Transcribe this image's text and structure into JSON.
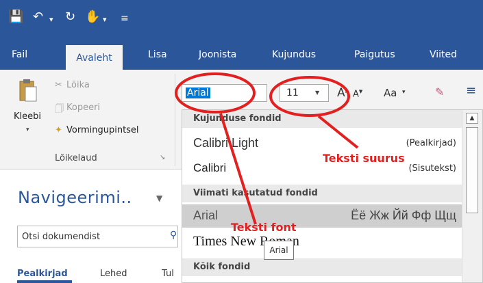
{
  "tabs": {
    "file": "Fail",
    "home": "Avaleht",
    "insert": "Lisa",
    "draw": "Joonista",
    "design": "Kujundus",
    "layout": "Paigutus",
    "references": "Viited"
  },
  "clipboard": {
    "cut": "Lõika",
    "copy": "Kopeeri",
    "paste": "Kleebi",
    "format_painter": "Vormingupintsel",
    "group_label": "Lõikelaud"
  },
  "font": {
    "name": "Arial",
    "size": "11",
    "case_label": "Aa"
  },
  "navigation": {
    "title": "Navigeerimi..",
    "search_placeholder": "Otsi dokumendist",
    "tabs": [
      "Pealkirjad",
      "Lehed",
      "Tul"
    ]
  },
  "dropdown": {
    "theme_header": "Kujunduse fondid",
    "theme_fonts": [
      {
        "name": "Calibri Light",
        "desc": "(Pealkirjad)"
      },
      {
        "name": "Calibri",
        "desc": "(Sisutekst)"
      }
    ],
    "recent_header": "Viimati kasutatud fondid",
    "recent_fonts": [
      {
        "name": "Arial",
        "sample": "Ёё Жж Йй Фф Щщ"
      },
      {
        "name": "Times New Roman"
      }
    ],
    "all_header": "Kõik fondid",
    "tooltip": "Arial"
  },
  "annotations": {
    "font_label": "Teksti font",
    "size_label": "Teksti suurus",
    "color": "#e32020"
  },
  "colors": {
    "accent": "#2b579a",
    "highlight": "#0078d7"
  }
}
